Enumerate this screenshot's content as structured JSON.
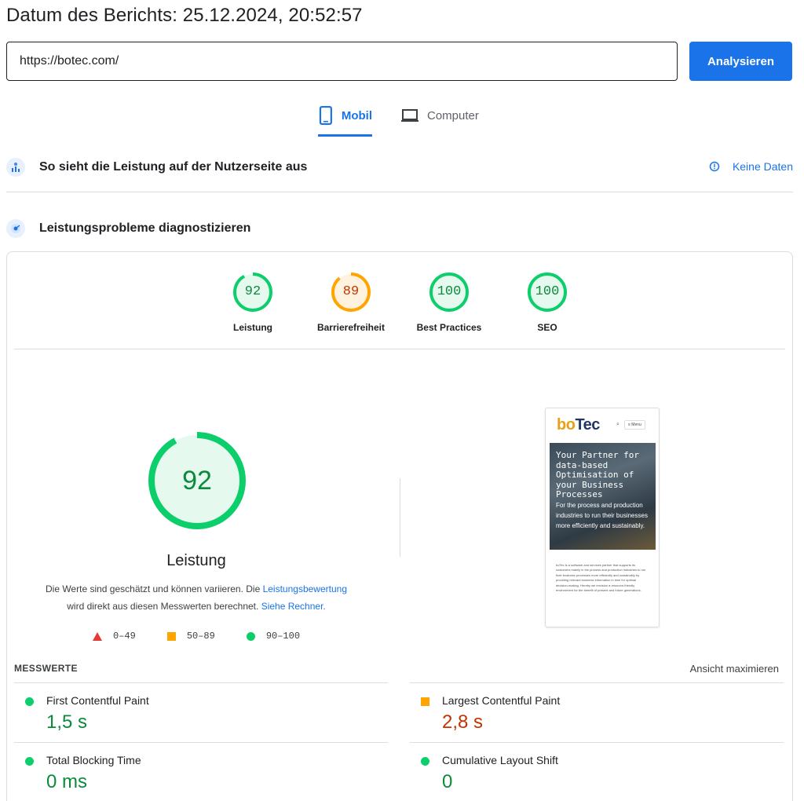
{
  "header": {
    "report_date": "Datum des Berichts: 25.12.2024, 20:52:57"
  },
  "search": {
    "url_value": "https://botec.com/",
    "analyze_label": "Analysieren"
  },
  "tabs": [
    {
      "label": "Mobil",
      "icon": "smartphone-icon",
      "active": true
    },
    {
      "label": "Computer",
      "icon": "laptop-icon",
      "active": false
    }
  ],
  "field_data": {
    "title": "So sieht die Leistung auf der Nutzerseite aus",
    "no_data_label": "Keine Daten",
    "icon": "users-chart-icon"
  },
  "diagnostics": {
    "title": "Leistungsprobleme diagnostizieren",
    "icon": "lighthouse-icon"
  },
  "scores": [
    {
      "label": "Leistung",
      "value": "92",
      "level": 0.92,
      "color": "#0cce6b",
      "text_color": "#0c8a3c"
    },
    {
      "label": "Barrierefreiheit",
      "value": "89",
      "level": 0.89,
      "color": "#ffa400",
      "text_color": "#c33300"
    },
    {
      "label": "Best Practices",
      "value": "100",
      "level": 1.0,
      "color": "#0cce6b",
      "text_color": "#0c8a3c"
    },
    {
      "label": "SEO",
      "value": "100",
      "level": 1.0,
      "color": "#0cce6b",
      "text_color": "#0c8a3c"
    }
  ],
  "performance": {
    "score": "92",
    "level": 0.92,
    "title": "Leistung",
    "desc_prefix": "Die Werte sind geschätzt und können variieren. Die ",
    "desc_link1": "Leistungsbewertung",
    "desc_middle": "wird direkt aus diesen Messwerten berechnet. ",
    "desc_link2": "Siehe Rechner."
  },
  "legend": [
    {
      "range": "0–49",
      "shape": "triangle",
      "color": "#e53935"
    },
    {
      "range": "50–89",
      "shape": "square",
      "color": "#ffa400"
    },
    {
      "range": "90–100",
      "shape": "circle",
      "color": "#0cce6b"
    }
  ],
  "screenshot": {
    "logo_part1": "bo",
    "logo_part2": "Tec",
    "menu_label": "≡ Menu",
    "hero_title": "Your Partner for data-based Optimisation of your Business Processes",
    "hero_text": "For the process and production industries to run their businesses more efficiently and sustainably.",
    "body_text": "boTec is a software and services partner that supports its customers mainly in the process and production industries to run their business processes more efficiently and sustainably by providing relevant business information in time for optimal decision-making. Hereby we envision a resource-friendly environment for the benefit of present and future generations."
  },
  "metrics": {
    "header": "MESSWERTE",
    "expand_label": "Ansicht maximieren",
    "items": [
      {
        "label": "First Contentful Paint",
        "value": "1,5 s",
        "status": "good"
      },
      {
        "label": "Largest Contentful Paint",
        "value": "2,8 s",
        "status": "average"
      },
      {
        "label": "Total Blocking Time",
        "value": "0 ms",
        "status": "good"
      },
      {
        "label": "Cumulative Layout Shift",
        "value": "0",
        "status": "good"
      }
    ]
  },
  "colors": {
    "accent": "#1a73e8",
    "good": "#0cce6b",
    "average": "#ffa400",
    "poor": "#e53935"
  }
}
